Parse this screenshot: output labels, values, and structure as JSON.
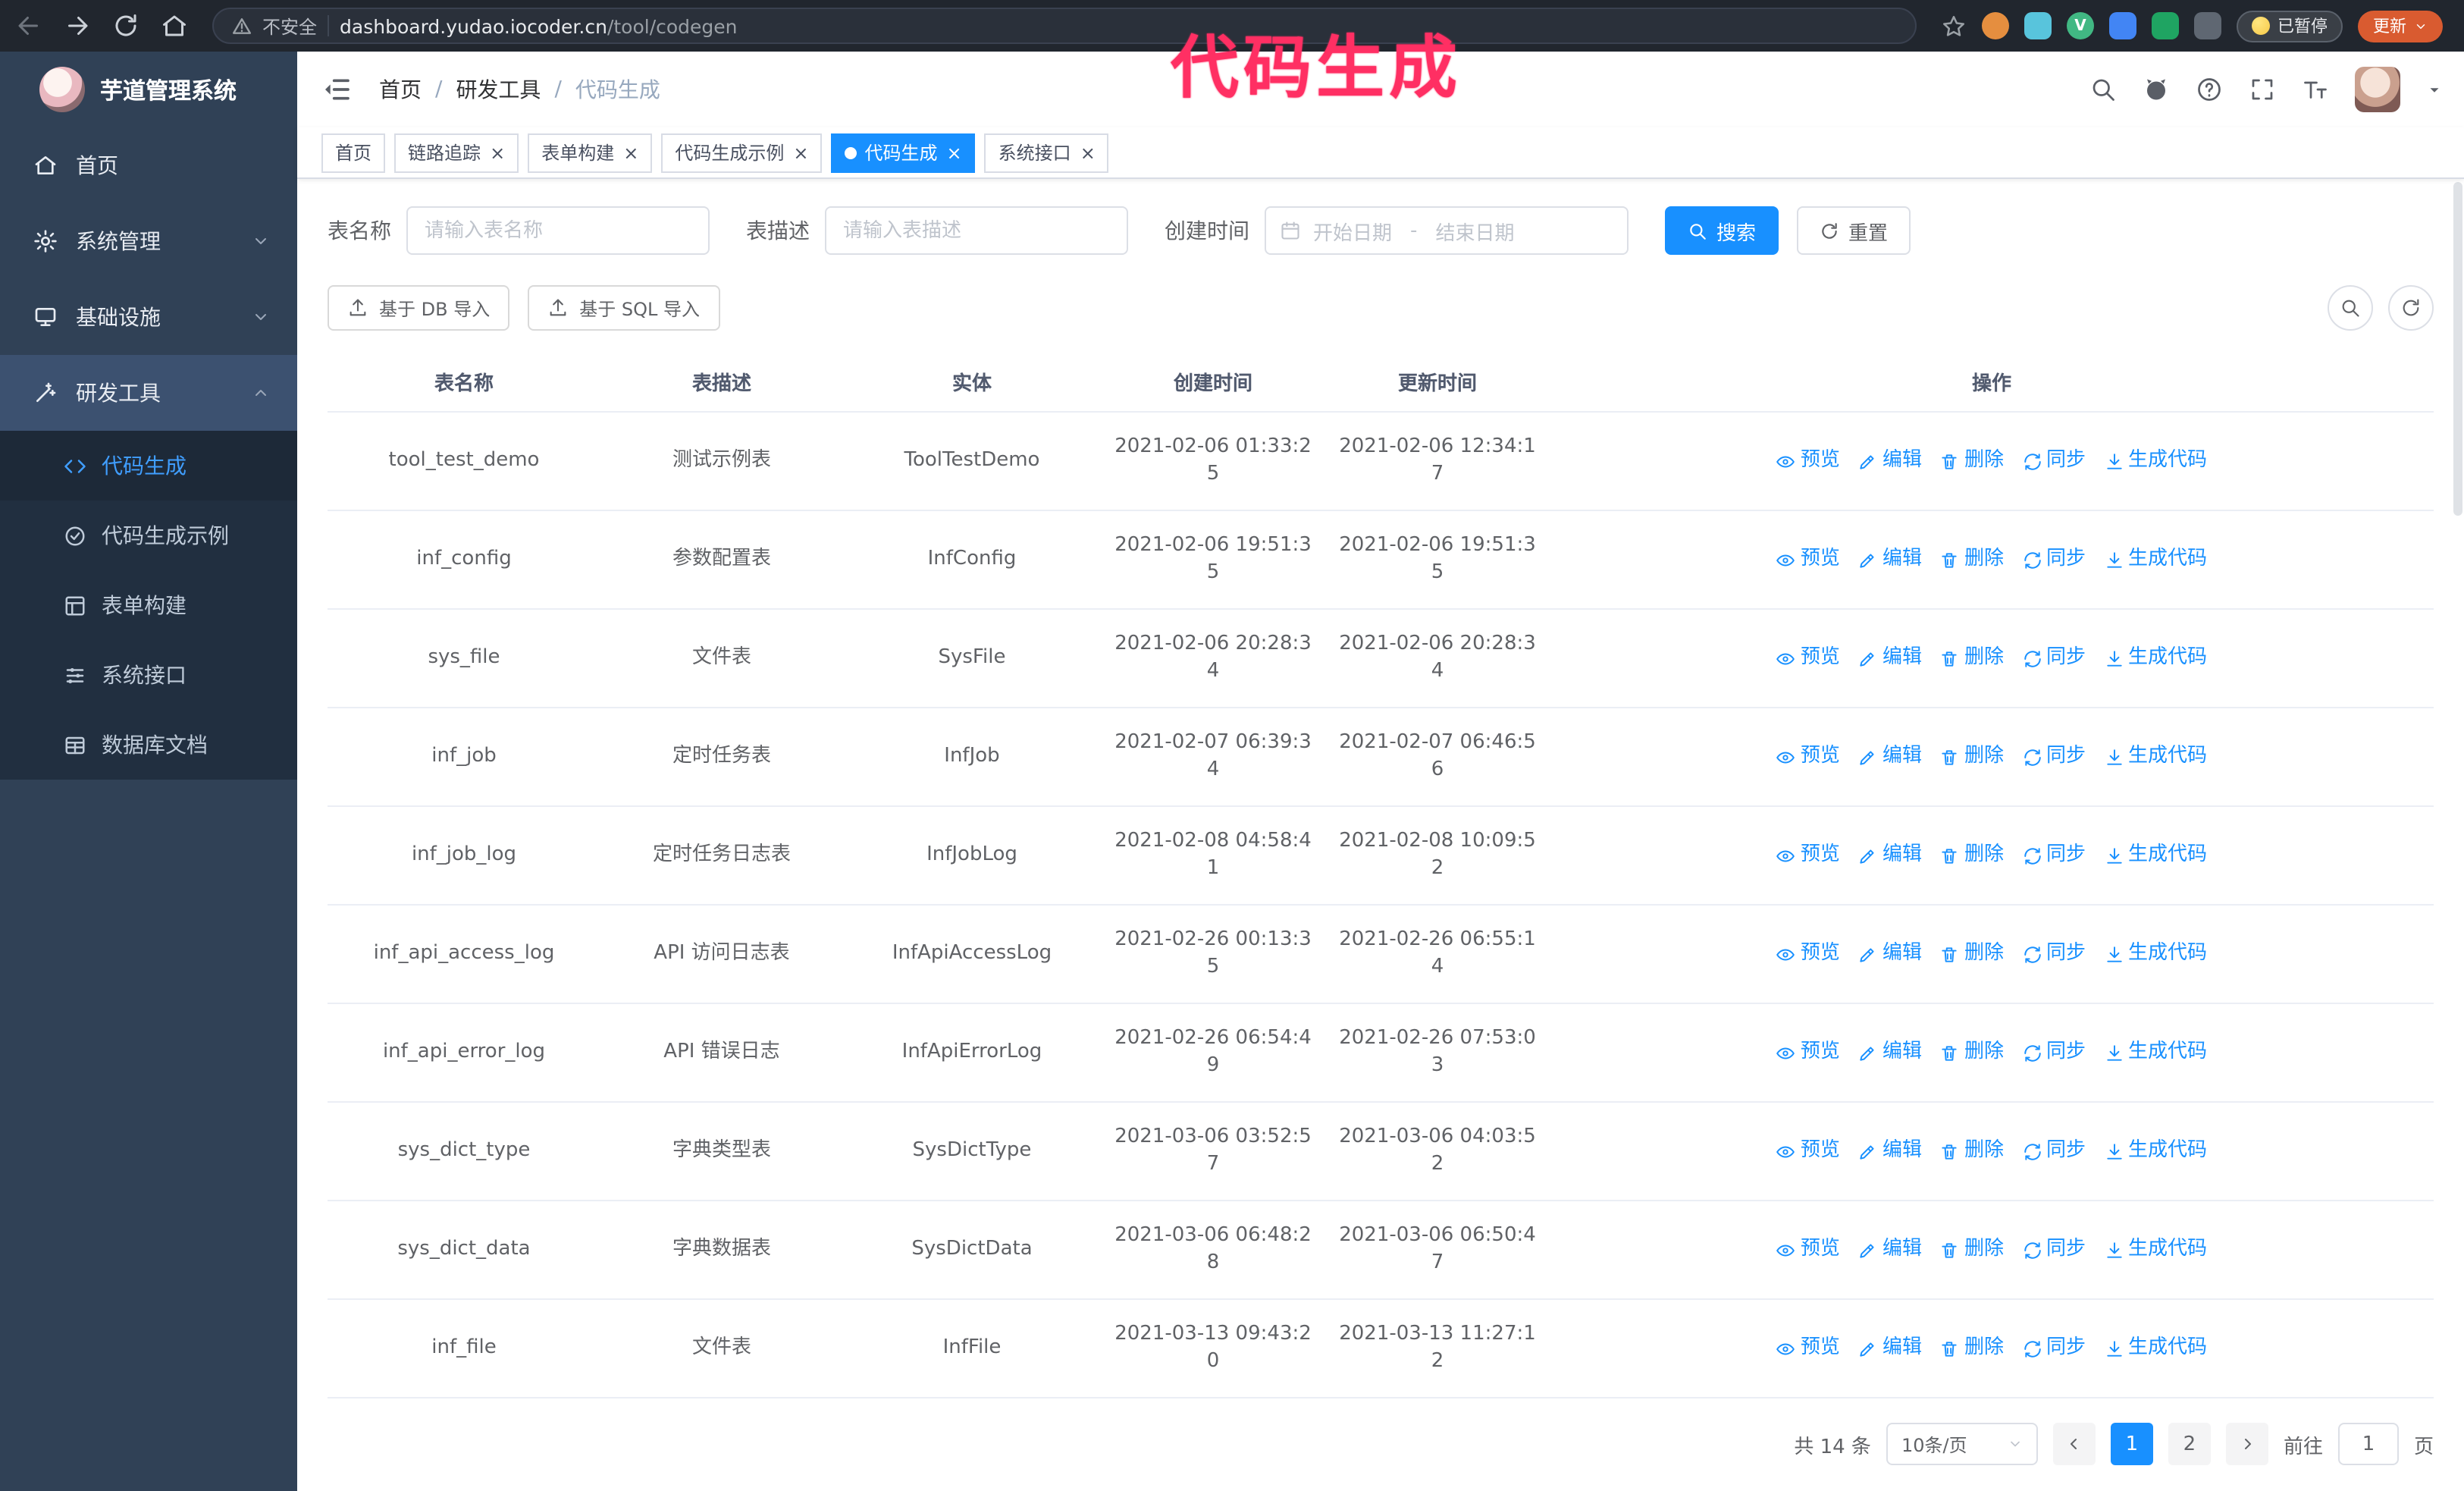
{
  "colors": {
    "primary": "#1890ff",
    "sidebar_bg": "#304156",
    "submenu_bg": "#212f40",
    "sidebar_active_text": "#409eff",
    "annotation": "#ff2f63",
    "update_button": "#d95b30"
  },
  "icons": {
    "close": "×",
    "breadcrumb_separator": "/"
  },
  "annotation": {
    "text": "代码生成"
  },
  "browser": {
    "security_label": "不安全",
    "url_host": "dashboard.yudao.iocoder.cn",
    "url_path": "/tool/codegen",
    "paused_badge": "已暂停",
    "update_button": "更新"
  },
  "sidebar": {
    "logo_title": "芋道管理系统",
    "items": [
      {
        "label": "首页"
      },
      {
        "label": "系统管理"
      },
      {
        "label": "基础设施"
      },
      {
        "label": "研发工具"
      }
    ],
    "submenu": [
      {
        "label": "代码生成",
        "active": true
      },
      {
        "label": "代码生成示例"
      },
      {
        "label": "表单构建"
      },
      {
        "label": "系统接口"
      },
      {
        "label": "数据库文档"
      }
    ]
  },
  "header": {
    "breadcrumb": [
      "首页",
      "研发工具",
      "代码生成"
    ]
  },
  "tabs": [
    {
      "label": "首页",
      "closable": false,
      "active": false
    },
    {
      "label": "链路追踪",
      "closable": true,
      "active": false
    },
    {
      "label": "表单构建",
      "closable": true,
      "active": false
    },
    {
      "label": "代码生成示例",
      "closable": true,
      "active": false
    },
    {
      "label": "代码生成",
      "closable": true,
      "active": true
    },
    {
      "label": "系统接口",
      "closable": true,
      "active": false
    }
  ],
  "filters": {
    "table_name_label": "表名称",
    "table_name_placeholder": "请输入表名称",
    "table_desc_label": "表描述",
    "table_desc_placeholder": "请输入表描述",
    "create_time_label": "创建时间",
    "date_start_placeholder": "开始日期",
    "date_separator": "-",
    "date_end_placeholder": "结束日期",
    "search_button": "搜索",
    "reset_button": "重置"
  },
  "toolbar": {
    "import_db": "基于 DB 导入",
    "import_sql": "基于 SQL 导入"
  },
  "table": {
    "columns": [
      "表名称",
      "表描述",
      "实体",
      "创建时间",
      "更新时间",
      "操作"
    ],
    "actions": [
      "预览",
      "编辑",
      "删除",
      "同步",
      "生成代码"
    ],
    "rows": [
      {
        "name": "tool_test_demo",
        "desc": "测试示例表",
        "entity": "ToolTestDemo",
        "created": "2021-02-06 01:33:25",
        "updated": "2021-02-06 12:34:17"
      },
      {
        "name": "inf_config",
        "desc": "参数配置表",
        "entity": "InfConfig",
        "created": "2021-02-06 19:51:35",
        "updated": "2021-02-06 19:51:35"
      },
      {
        "name": "sys_file",
        "desc": "文件表",
        "entity": "SysFile",
        "created": "2021-02-06 20:28:34",
        "updated": "2021-02-06 20:28:34"
      },
      {
        "name": "inf_job",
        "desc": "定时任务表",
        "entity": "InfJob",
        "created": "2021-02-07 06:39:34",
        "updated": "2021-02-07 06:46:56"
      },
      {
        "name": "inf_job_log",
        "desc": "定时任务日志表",
        "entity": "InfJobLog",
        "created": "2021-02-08 04:58:41",
        "updated": "2021-02-08 10:09:52"
      },
      {
        "name": "inf_api_access_log",
        "desc": "API 访问日志表",
        "entity": "InfApiAccessLog",
        "created": "2021-02-26 00:13:35",
        "updated": "2021-02-26 06:55:14"
      },
      {
        "name": "inf_api_error_log",
        "desc": "API 错误日志",
        "entity": "InfApiErrorLog",
        "created": "2021-02-26 06:54:49",
        "updated": "2021-02-26 07:53:03"
      },
      {
        "name": "sys_dict_type",
        "desc": "字典类型表",
        "entity": "SysDictType",
        "created": "2021-03-06 03:52:57",
        "updated": "2021-03-06 04:03:52"
      },
      {
        "name": "sys_dict_data",
        "desc": "字典数据表",
        "entity": "SysDictData",
        "created": "2021-03-06 06:48:28",
        "updated": "2021-03-06 06:50:47"
      },
      {
        "name": "inf_file",
        "desc": "文件表",
        "entity": "InfFile",
        "created": "2021-03-13 09:43:20",
        "updated": "2021-03-13 11:27:12"
      }
    ]
  },
  "pagination": {
    "total": "共 14 条",
    "page_size": "10条/页",
    "pages": [
      "1",
      "2"
    ],
    "active_page": "1",
    "goto_label": "前往",
    "goto_value": "1",
    "goto_suffix": "页"
  }
}
